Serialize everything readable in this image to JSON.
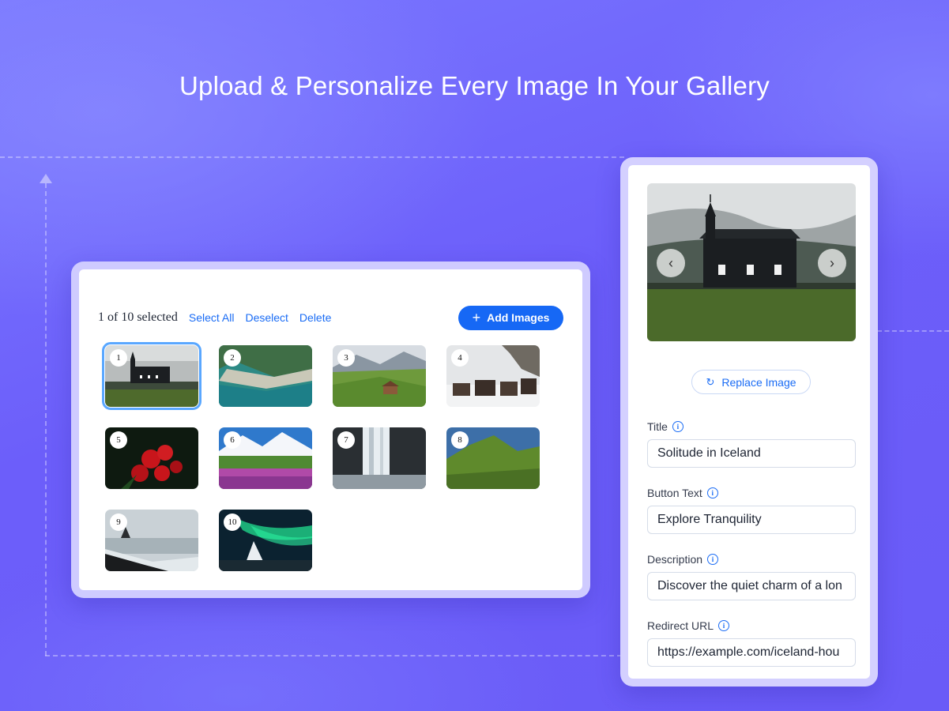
{
  "headline": "Upload & Personalize Every Image In Your Gallery",
  "gallery": {
    "selected_count": "1 of 10 selected",
    "select_all": "Select All",
    "deselect": "Deselect",
    "delete": "Delete",
    "add_images": "Add Images",
    "thumbnails": [
      {
        "number": "1",
        "subject": "black church under misty sky",
        "selected": true
      },
      {
        "number": "2",
        "subject": "aerial turquoise coastline"
      },
      {
        "number": "3",
        "subject": "alpine village valley"
      },
      {
        "number": "4",
        "subject": "snowy village houses"
      },
      {
        "number": "5",
        "subject": "red roses"
      },
      {
        "number": "6",
        "subject": "wildflower meadow and snowy mountains"
      },
      {
        "number": "7",
        "subject": "waterfall"
      },
      {
        "number": "8",
        "subject": "green hills"
      },
      {
        "number": "9",
        "subject": "black sand beach"
      },
      {
        "number": "10",
        "subject": "aurora borealis"
      }
    ]
  },
  "editor": {
    "prev_icon": "chevron-left-icon",
    "next_icon": "chevron-right-icon",
    "replace_image": "Replace Image",
    "fields": {
      "title_label": "Title",
      "title_value": "Solitude in Iceland",
      "button_text_label": "Button Text",
      "button_text_value": "Explore Tranquility",
      "description_label": "Description",
      "description_value": "Discover the quiet charm of a lon",
      "redirect_url_label": "Redirect URL",
      "redirect_url_value": "https://example.com/iceland-hou"
    }
  },
  "colors": {
    "background": "#6b5ef8",
    "accent": "#1668f5",
    "selection_outline": "#59a7ff"
  }
}
